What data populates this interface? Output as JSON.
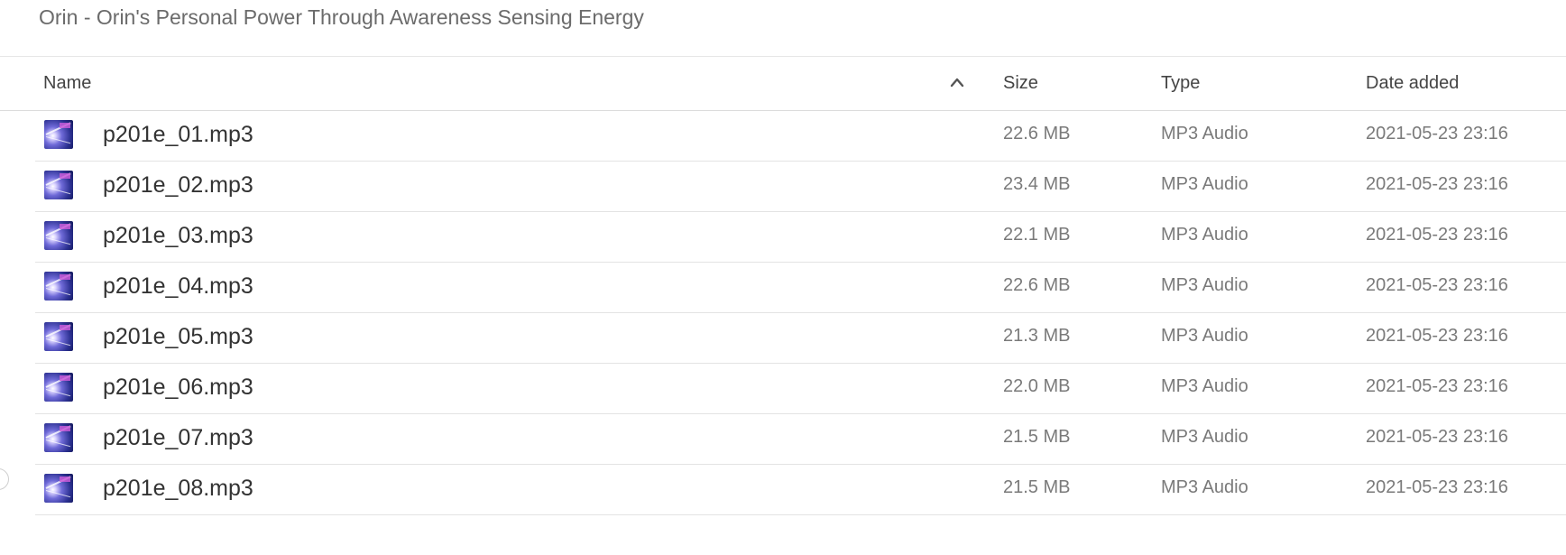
{
  "folder": {
    "title": "Orin - Orin's Personal Power Through Awareness Sensing Energy"
  },
  "table": {
    "columns": {
      "name": "Name",
      "size": "Size",
      "type": "Type",
      "date_added": "Date added"
    },
    "sort": {
      "column": "name",
      "direction": "ascending",
      "icon": "chevron-up-icon"
    },
    "thumbnail_icon": "album-art-thumbnail",
    "rows": [
      {
        "name": "p201e_01.mp3",
        "size": "22.6 MB",
        "type": "MP3 Audio",
        "date_added": "2021-05-23 23:16"
      },
      {
        "name": "p201e_02.mp3",
        "size": "23.4 MB",
        "type": "MP3 Audio",
        "date_added": "2021-05-23 23:16"
      },
      {
        "name": "p201e_03.mp3",
        "size": "22.1 MB",
        "type": "MP3 Audio",
        "date_added": "2021-05-23 23:16"
      },
      {
        "name": "p201e_04.mp3",
        "size": "22.6 MB",
        "type": "MP3 Audio",
        "date_added": "2021-05-23 23:16"
      },
      {
        "name": "p201e_05.mp3",
        "size": "21.3 MB",
        "type": "MP3 Audio",
        "date_added": "2021-05-23 23:16"
      },
      {
        "name": "p201e_06.mp3",
        "size": "22.0 MB",
        "type": "MP3 Audio",
        "date_added": "2021-05-23 23:16"
      },
      {
        "name": "p201e_07.mp3",
        "size": "21.5 MB",
        "type": "MP3 Audio",
        "date_added": "2021-05-23 23:16"
      },
      {
        "name": "p201e_08.mp3",
        "size": "21.5 MB",
        "type": "MP3 Audio",
        "date_added": "2021-05-23 23:16"
      }
    ]
  },
  "colors": {
    "title_text": "#6b6b6b",
    "primary_text": "#333333",
    "secondary_text": "#7a7a7a",
    "divider": "#e3e3e3"
  }
}
